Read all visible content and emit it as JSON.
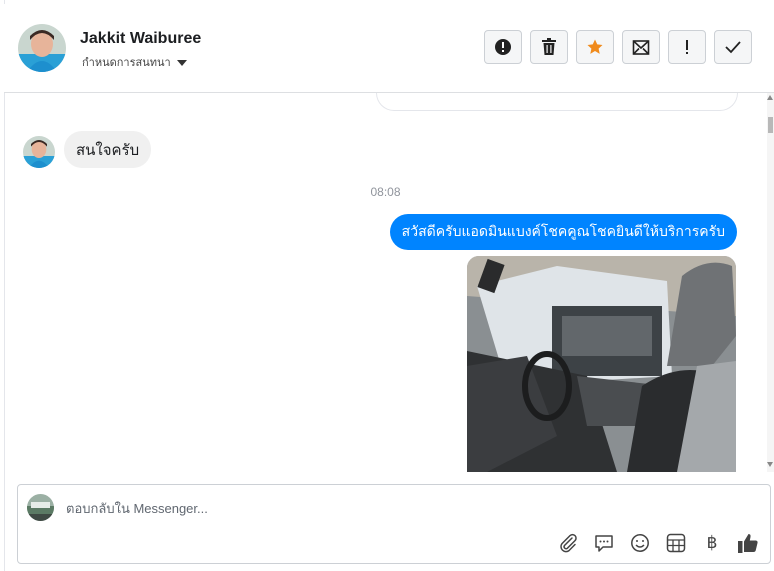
{
  "header": {
    "contact_name": "Jakkit Waiburee",
    "subtitle": "กำหนดการสนทนา",
    "action_icons": [
      "alert-circle-icon",
      "trash-icon",
      "star-icon",
      "mark-unread-icon",
      "exclamation-icon",
      "check-icon"
    ]
  },
  "thread": {
    "incoming_message": "สนใจครับ",
    "timestamp": "08:08",
    "outgoing_message": "สวัสดีครับแอดมินแบงค์โชคคูณโชคยินดีให้บริการครับ",
    "photo_icon": "car-interior-photo"
  },
  "composer": {
    "placeholder": "ตอบกลับใน Messenger...",
    "tools": [
      "attach-icon",
      "saved-replies-icon",
      "emoji-icon",
      "table-icon",
      "baht-icon",
      "like-icon"
    ],
    "baht_symbol": "฿"
  },
  "colors": {
    "accent_blue": "#0084ff",
    "star_orange": "#f08b1d",
    "incoming_bubble": "#f0f0f0"
  }
}
